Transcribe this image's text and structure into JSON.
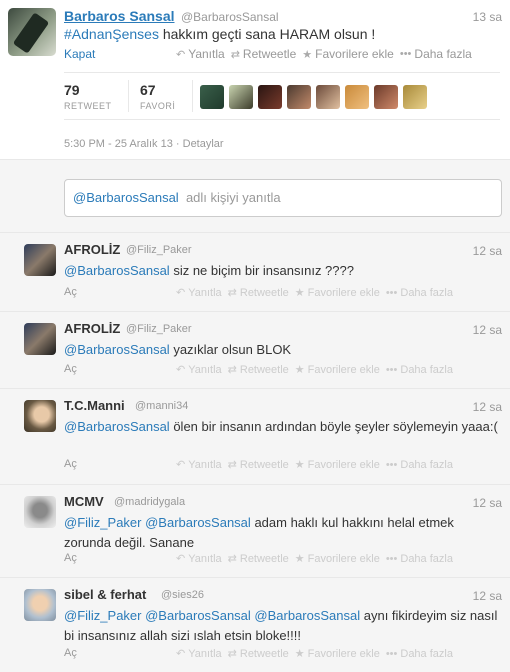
{
  "main_tweet": {
    "name": "Barbaros Sansal",
    "handle": "@BarbarosSansal",
    "time": "13 sa",
    "hashtag": "#AdnanŞenses",
    "text": "hakkım geçti sana HARAM olsun !",
    "collapse": "Kapat",
    "actions": {
      "reply": "Yanıtla",
      "retweet": "Retweetle",
      "favorite": "Favorilere ekle",
      "more": "Daha fazla"
    },
    "stats": {
      "retweet_count": "79",
      "retweet_label": "RETWEET",
      "favorite_count": "67",
      "favorite_label": "FAVORİ"
    },
    "date": "5:30 PM - 25 Aralık 13",
    "details": "Detaylar"
  },
  "reply_box": {
    "mention": "@BarbarosSansal",
    "placeholder": "adlı kişiyi yanıtla"
  },
  "replies": [
    {
      "name": "AFROLİZ",
      "handle": "@Filiz_Paker",
      "time": "12 sa",
      "mention": "@BarbarosSansal",
      "text": "siz ne biçim bir insansınız ????",
      "expand": "Aç"
    },
    {
      "name": "AFROLİZ",
      "handle": "@Filiz_Paker",
      "time": "12 sa",
      "mention": "@BarbarosSansal",
      "text": "yazıklar olsun BLOK",
      "expand": "Aç"
    },
    {
      "name": "T.C.Manni",
      "handle": "@manni34",
      "time": "12 sa",
      "mention": "@BarbarosSansal",
      "text": "ölen bir insanın ardından böyle şeyler söylemeyin yaaa:(",
      "expand": "Aç"
    },
    {
      "name": "MCMV",
      "handle": "@madridygala",
      "time": "12 sa",
      "mention": "@Filiz_Paker @BarbarosSansal",
      "text": "adam haklı kul hakkını helal etmek zorunda değil. Sanane",
      "expand": "Aç"
    },
    {
      "name": "sibel & ferhat",
      "handle": "@sies26",
      "time": "12 sa",
      "mention": "@Filiz_Paker @BarbarosSansal @BarbarosSansal",
      "text": "aynı fikirdeyim siz nasıl bi insansınız allah sizi ıslah etsin bloke!!!!",
      "expand": "Aç"
    }
  ],
  "icons": {
    "reply": "reply-icon",
    "retweet": "retweet-icon",
    "favorite": "star-icon",
    "more": "more-icon"
  }
}
